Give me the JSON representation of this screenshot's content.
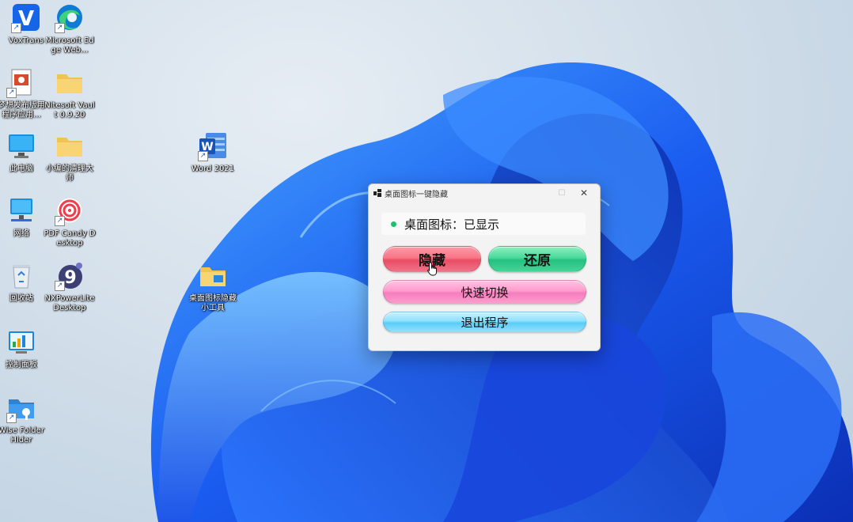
{
  "desktop": {
    "icons": [
      {
        "label": "VoxTrans",
        "icon": "voxtrans-icon"
      },
      {
        "label": "Microsoft Edge Web...",
        "icon": "edge-icon"
      },
      {
        "label": "梦想发布版用 程序应用...",
        "icon": "presentation-icon"
      },
      {
        "label": "Nitesoft Vault 0.9.20",
        "icon": "folder-icon"
      },
      {
        "label": "此电脑",
        "icon": "monitor-icon"
      },
      {
        "label": "小编的清理大师",
        "icon": "folder-icon"
      },
      {
        "label": "网络",
        "icon": "network-icon"
      },
      {
        "label": "PDF Candy Desktop",
        "icon": "pdf-candy-icon"
      },
      {
        "label": "回收站",
        "icon": "recycle-bin-icon"
      },
      {
        "label": "NXPowerLite Desktop",
        "icon": "nxpowerlite-icon"
      },
      {
        "label": "控制面板",
        "icon": "control-panel-icon"
      },
      {
        "label": "Wise Folder Hider",
        "icon": "wise-folder-hider-icon"
      },
      {
        "label": "Word 2021",
        "icon": "word-icon"
      },
      {
        "label": "桌面图标隐藏 小工具",
        "icon": "folder-icon"
      }
    ]
  },
  "app": {
    "title": "桌面图标一键隐藏",
    "minimize_symbol": "—",
    "maximize_symbol": "☐",
    "close_symbol": "✕",
    "status_label": "桌面图标：",
    "status_value": "已显示",
    "status_color": "#1fbf6e",
    "hide_label": "隐藏",
    "restore_label": "还原",
    "toggle_label": "快速切换",
    "exit_label": "退出程序"
  }
}
